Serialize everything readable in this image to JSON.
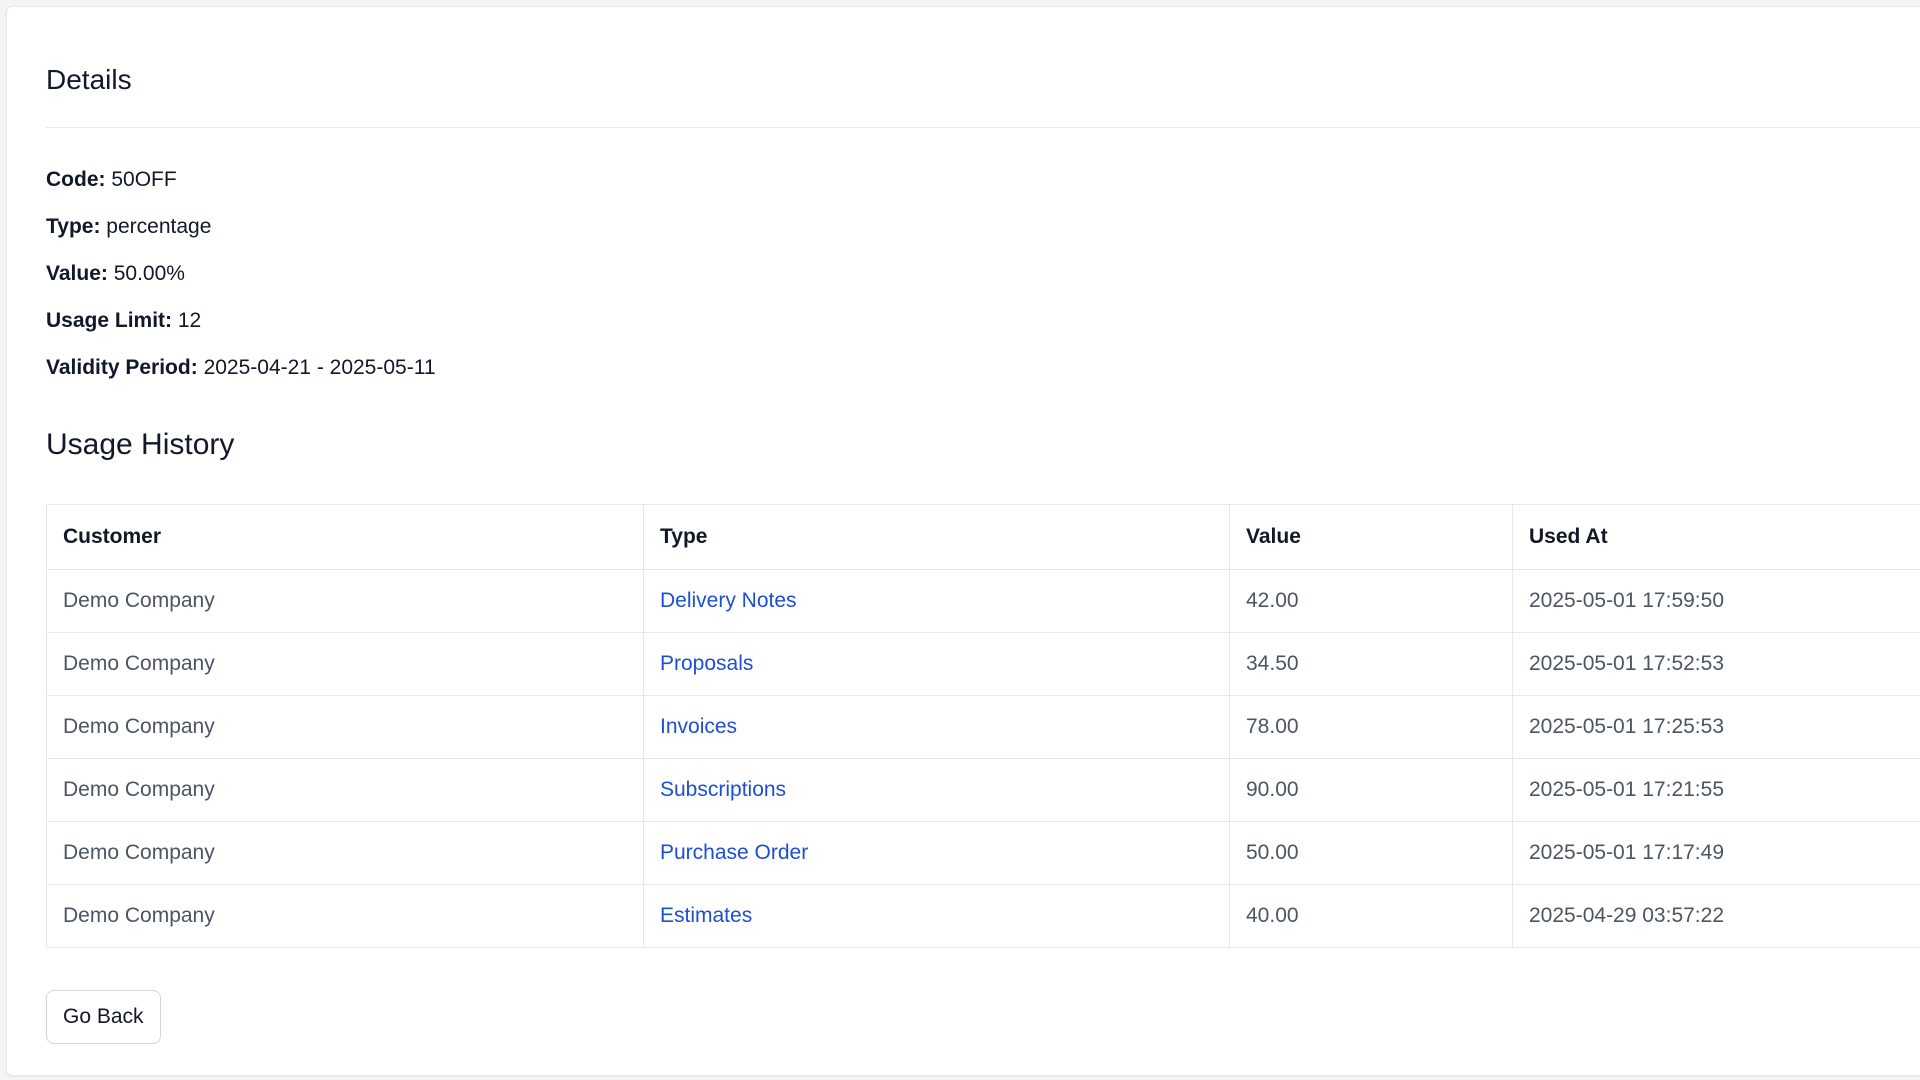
{
  "details": {
    "title": "Details",
    "fields": [
      {
        "label": "Code:",
        "value": "50OFF"
      },
      {
        "label": "Type:",
        "value": "percentage"
      },
      {
        "label": "Value:",
        "value": "50.00%"
      },
      {
        "label": "Usage Limit:",
        "value": "12"
      },
      {
        "label": "Validity Period:",
        "value": "2025-04-21 - 2025-05-11"
      }
    ]
  },
  "usage_history": {
    "title": "Usage History",
    "columns": [
      "Customer",
      "Type",
      "Value",
      "Used At"
    ],
    "rows": [
      {
        "customer": "Demo Company",
        "type": "Delivery Notes",
        "value": "42.00",
        "used_at": "2025-05-01 17:59:50"
      },
      {
        "customer": "Demo Company",
        "type": "Proposals",
        "value": "34.50",
        "used_at": "2025-05-01 17:52:53"
      },
      {
        "customer": "Demo Company",
        "type": "Invoices",
        "value": "78.00",
        "used_at": "2025-05-01 17:25:53"
      },
      {
        "customer": "Demo Company",
        "type": "Subscriptions",
        "value": "90.00",
        "used_at": "2025-05-01 17:21:55"
      },
      {
        "customer": "Demo Company",
        "type": "Purchase Order",
        "value": "50.00",
        "used_at": "2025-05-01 17:17:49"
      },
      {
        "customer": "Demo Company",
        "type": "Estimates",
        "value": "40.00",
        "used_at": "2025-04-29 03:57:22"
      }
    ]
  },
  "actions": {
    "go_back_label": "Go Back"
  },
  "colors": {
    "link": "#1d4ed8",
    "border": "#e5e7eb",
    "text": "#111827",
    "muted_text": "#4b5563"
  }
}
